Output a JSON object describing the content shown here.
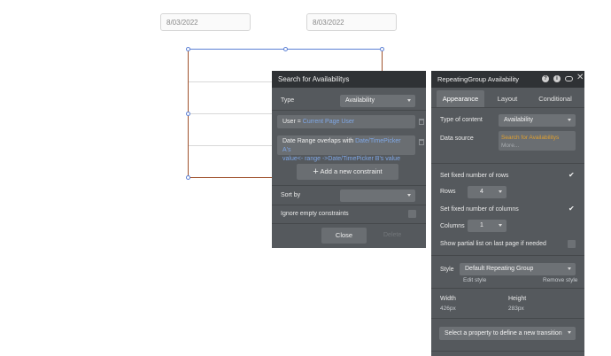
{
  "canvas": {
    "date_input_1": "8/03/2022",
    "date_input_2": "8/03/2022"
  },
  "search_panel": {
    "title": "Search for Availabilitys",
    "type_label": "Type",
    "type_value": "Availability",
    "constraint1_prefix": "User = ",
    "constraint1_value": "Current Page User",
    "constraint2_prefix": "Date Range  overlaps with ",
    "constraint2_value_a": "Date/TimePicker A's",
    "constraint2_value_b": "value<- range ->Date/TimePicker B's value",
    "add_constraint_label": "Add a new constraint",
    "sort_by_label": "Sort by",
    "sort_by_value": "",
    "ignore_empty_label": "Ignore empty constraints",
    "close_label": "Close",
    "delete_label": "Delete"
  },
  "rg_panel": {
    "title": "RepeatingGroup Availability",
    "tabs": [
      "Appearance",
      "Layout",
      "Conditional"
    ],
    "type_of_content_label": "Type of content",
    "type_of_content_value": "Availability",
    "data_source_label": "Data source",
    "data_source_value": "Search for Availabilitys",
    "data_source_more": "More...",
    "fixed_rows_label": "Set fixed number of rows",
    "rows_label": "Rows",
    "rows_value": "4",
    "fixed_columns_label": "Set fixed number of columns",
    "columns_label": "Columns",
    "columns_value": "1",
    "partial_list_label": "Show partial list on last page if needed",
    "style_label": "Style",
    "style_value": "Default Repeating Group",
    "edit_style": "Edit style",
    "remove_style": "Remove style",
    "width_label": "Width",
    "width_value": "426px",
    "height_label": "Height",
    "height_value": "283px",
    "transition_placeholder": "Select a property to define a new transition"
  },
  "colors": {
    "panel_bg": "#55595d",
    "header_bg": "#2f3235",
    "link_blue": "#7fa7e6",
    "data_source_orange": "#e0a030"
  }
}
